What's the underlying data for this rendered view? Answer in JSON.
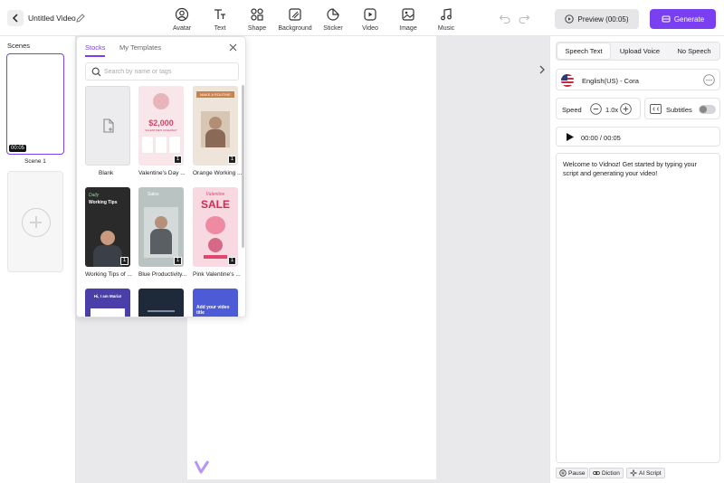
{
  "header": {
    "title": "Untitled Video",
    "tools": [
      {
        "label": "Avatar",
        "icon": "avatar-icon"
      },
      {
        "label": "Text",
        "icon": "text-icon"
      },
      {
        "label": "Shape",
        "icon": "shape-icon"
      },
      {
        "label": "Background",
        "icon": "background-icon"
      },
      {
        "label": "Sticker",
        "icon": "sticker-icon"
      },
      {
        "label": "Video",
        "icon": "video-icon"
      },
      {
        "label": "Image",
        "icon": "image-icon"
      },
      {
        "label": "Music",
        "icon": "music-icon"
      }
    ],
    "preview_label": "Preview (00:05)",
    "generate_label": "Generate"
  },
  "scenes": {
    "label": "Scenes",
    "items": [
      {
        "name": "Scene 1",
        "duration": "00:05"
      }
    ]
  },
  "template_panel": {
    "tabs": [
      {
        "label": "Stocks",
        "active": true
      },
      {
        "label": "My Templates",
        "active": false
      }
    ],
    "search_placeholder": "Search by name or tags",
    "templates": [
      {
        "label": "Blank",
        "badge": ""
      },
      {
        "label": "Valentine's Day ...",
        "badge": "1",
        "card_price": "$2,000",
        "card_caption": "VALENTINE'S GIVEAWAY"
      },
      {
        "label": "Orange Working ...",
        "badge": "1",
        "card_heading": "MAKE A ROUTINE"
      },
      {
        "label": "Working Tips of ...",
        "badge": "1",
        "card_heading": "Daily",
        "card_subheading": "Working Tips"
      },
      {
        "label": "Blue Productivity...",
        "badge": "1",
        "card_heading": "Sales"
      },
      {
        "label": "Pink Valentine's ...",
        "badge": "1",
        "card_heading": "Valentine",
        "card_subheading": "SALE"
      },
      {
        "label": "",
        "badge": "",
        "card_heading": "Hi, I am Maria!"
      },
      {
        "label": "",
        "badge": ""
      },
      {
        "label": "",
        "badge": "",
        "card_heading": "Add your video title"
      }
    ]
  },
  "right_panel": {
    "tabs": [
      {
        "label": "Speech Text",
        "active": true
      },
      {
        "label": "Upload Voice",
        "active": false
      },
      {
        "label": "No Speech",
        "active": false
      }
    ],
    "voice": "English(US) - Cora",
    "speed_label": "Speed",
    "speed_value": "1.0x",
    "subtitles_label": "Subtitles",
    "subtitles_on": false,
    "time": "00:00 / 00:05",
    "script": "Welcome to Vidnoz! Get started by typing your script and generating your video!",
    "chips": [
      "Pause",
      "Diction",
      "AI Script"
    ]
  },
  "colors": {
    "accent": "#7b3ff2",
    "canvas_bg": "#e9e9ec"
  }
}
